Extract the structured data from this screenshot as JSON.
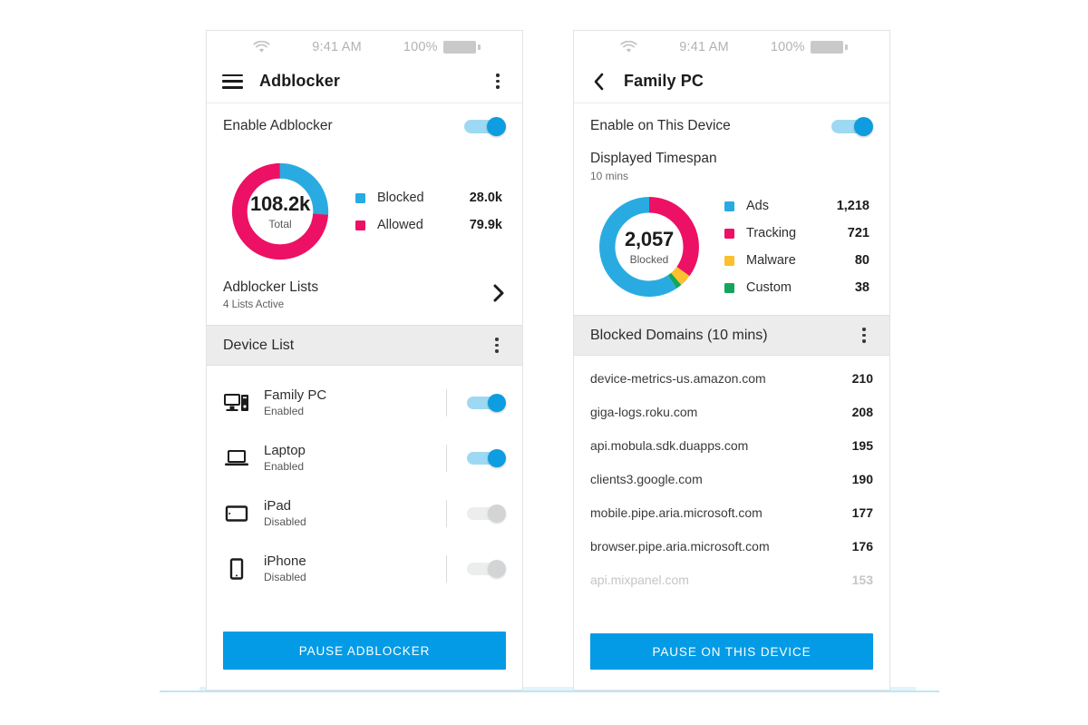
{
  "colors": {
    "blue": "#29abe2",
    "pink": "#ec1164",
    "yellow": "#fbc02d",
    "green": "#13a65b",
    "toggle_on_knob": "#0d9de0",
    "toggle_on_track": "#9ed9f3",
    "cta": "#039be5",
    "section_header_bg": "#ececec"
  },
  "left_phone": {
    "status_bar": {
      "wifi_icon": "wifi-icon",
      "time": "9:41 AM",
      "battery_percent": "100%",
      "battery_icon": "battery-full-icon"
    },
    "app_bar": {
      "menu_icon": "hamburger-menu-icon",
      "title": "Adblocker",
      "overflow_icon": "more-vertical-icon"
    },
    "enable_row": {
      "label": "Enable Adblocker",
      "toggle_state": "on"
    },
    "chart_data": {
      "type": "pie",
      "title": "Adblocker Totals",
      "center_value": "108.2k",
      "center_label": "Total",
      "categories": [
        "Blocked",
        "Allowed"
      ],
      "values": [
        28000,
        79900
      ],
      "value_labels": [
        "28.0k",
        "79.9k"
      ],
      "colors": [
        "#29abe2",
        "#ec1164"
      ],
      "legend_position": "right",
      "donut": true
    },
    "lists_row": {
      "title": "Adblocker Lists",
      "subtitle": "4 Lists Active",
      "chevron_icon": "chevron-right-icon"
    },
    "device_section": {
      "title": "Device List",
      "overflow_icon": "more-vertical-icon",
      "devices": [
        {
          "icon": "desktop-pc-icon",
          "name": "Family PC",
          "status": "Enabled",
          "toggle_state": "on"
        },
        {
          "icon": "laptop-icon",
          "name": "Laptop",
          "status": "Enabled",
          "toggle_state": "on"
        },
        {
          "icon": "tablet-icon",
          "name": "iPad",
          "status": "Disabled",
          "toggle_state": "off"
        },
        {
          "icon": "phone-icon",
          "name": "iPhone",
          "status": "Disabled",
          "toggle_state": "off"
        }
      ]
    },
    "cta_label": "PAUSE ADBLOCKER"
  },
  "right_phone": {
    "status_bar": {
      "wifi_icon": "wifi-icon",
      "time": "9:41 AM",
      "battery_percent": "100%",
      "battery_icon": "battery-full-icon"
    },
    "app_bar": {
      "back_icon": "chevron-left-icon",
      "title": "Family PC"
    },
    "enable_row": {
      "label": "Enable on This Device",
      "toggle_state": "on"
    },
    "timespan": {
      "label": "Displayed Timespan",
      "value": "10 mins"
    },
    "chart_data": {
      "type": "pie",
      "title": "Blocked Breakdown",
      "center_value": "2,057",
      "center_label": "Blocked",
      "categories": [
        "Ads",
        "Tracking",
        "Malware",
        "Custom"
      ],
      "values": [
        1218,
        721,
        80,
        38
      ],
      "value_labels": [
        "1,218",
        "721",
        "80",
        "38"
      ],
      "colors": [
        "#29abe2",
        "#ec1164",
        "#fbc02d",
        "#13a65b"
      ],
      "legend_position": "right",
      "donut": true
    },
    "domains_section": {
      "title": "Blocked Domains (10 mins)",
      "overflow_icon": "more-vertical-icon",
      "rows": [
        {
          "domain": "device-metrics-us.amazon.com",
          "count": "210",
          "faded": false
        },
        {
          "domain": "giga-logs.roku.com",
          "count": "208",
          "faded": false
        },
        {
          "domain": "api.mobula.sdk.duapps.com",
          "count": "195",
          "faded": false
        },
        {
          "domain": "clients3.google.com",
          "count": "190",
          "faded": false
        },
        {
          "domain": "mobile.pipe.aria.microsoft.com",
          "count": "177",
          "faded": false
        },
        {
          "domain": "browser.pipe.aria.microsoft.com",
          "count": "176",
          "faded": false
        },
        {
          "domain": "api.mixpanel.com",
          "count": "153",
          "faded": true
        }
      ]
    },
    "cta_label": "PAUSE ON THIS DEVICE"
  }
}
